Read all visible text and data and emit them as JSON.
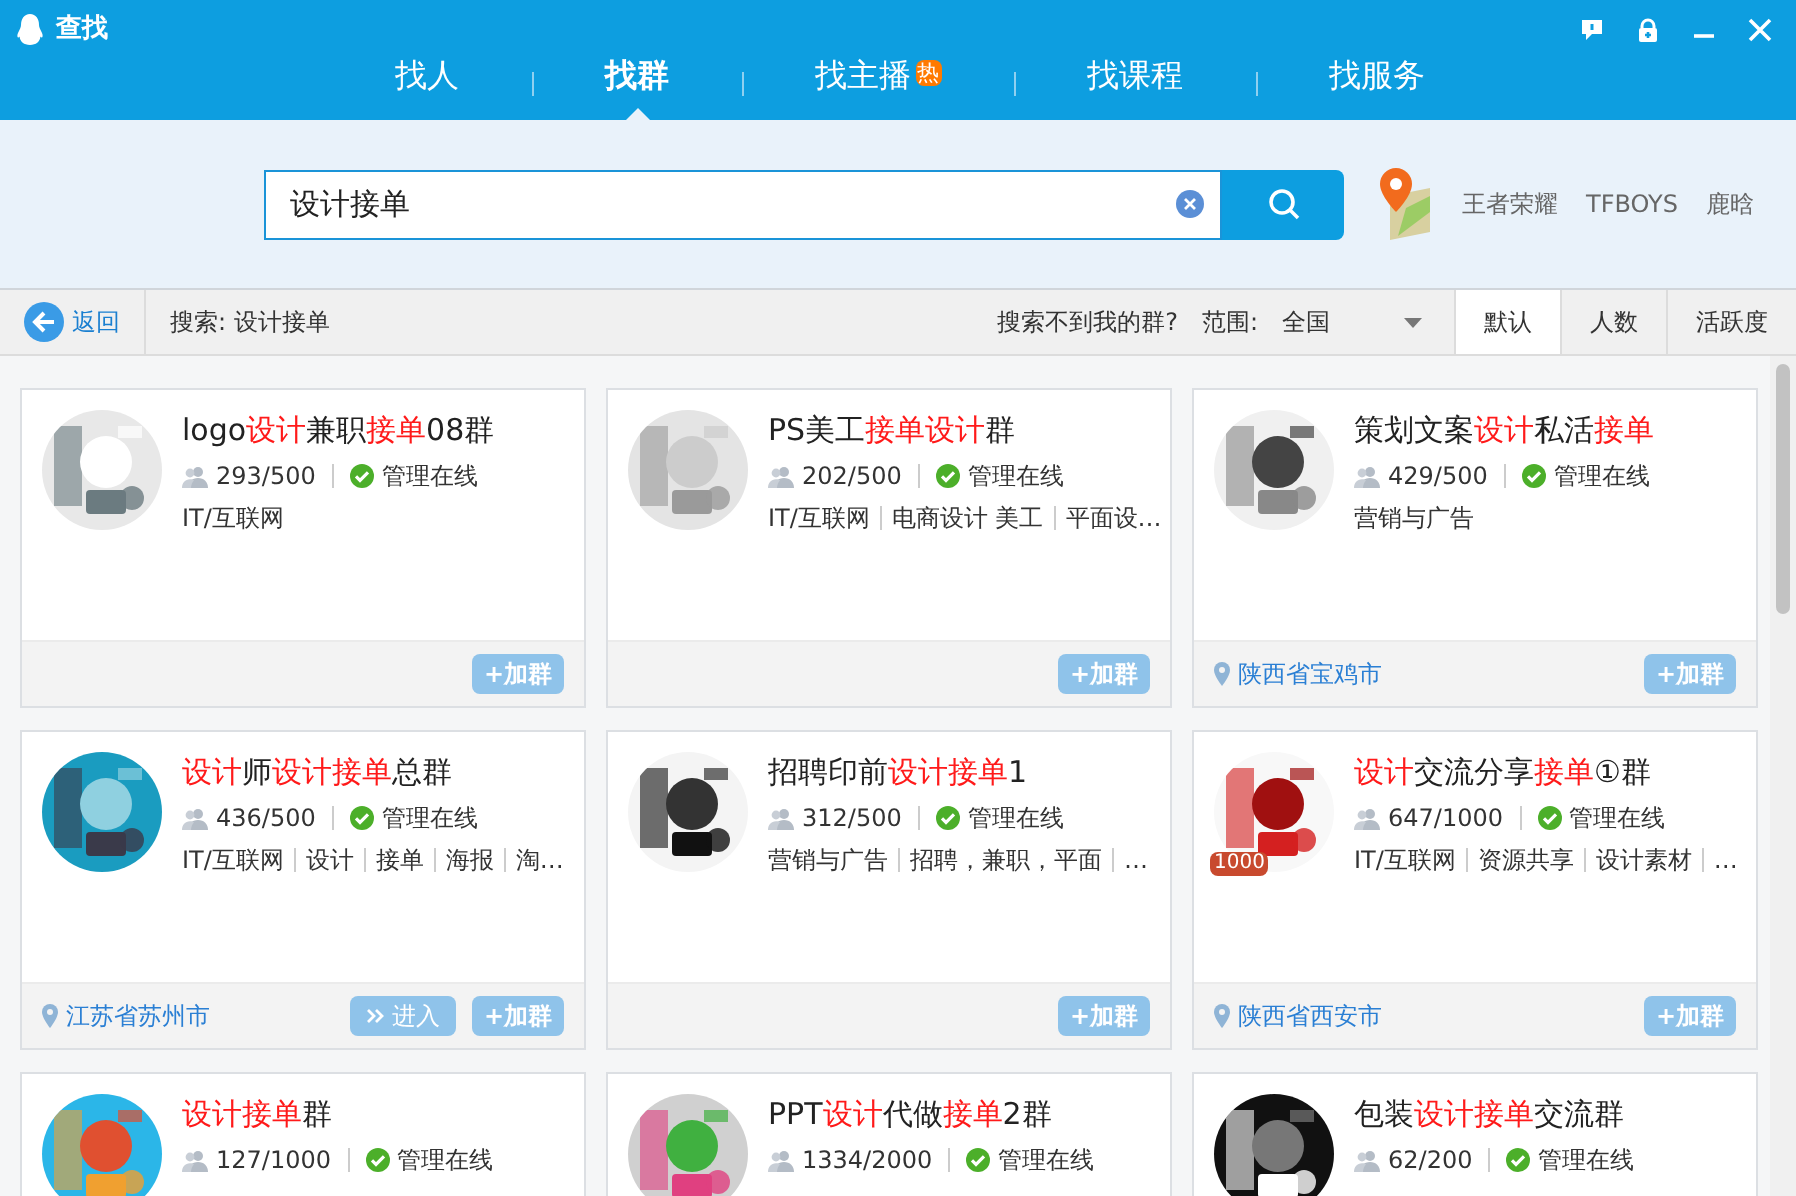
{
  "window": {
    "title": "查找"
  },
  "tabs": [
    {
      "label": "找人",
      "selected": false
    },
    {
      "label": "找群",
      "selected": true
    },
    {
      "label": "找主播",
      "selected": false,
      "badge": "热"
    },
    {
      "label": "找课程",
      "selected": false
    },
    {
      "label": "找服务",
      "selected": false
    }
  ],
  "search": {
    "value": "设计接单"
  },
  "hot_words": [
    "王者荣耀",
    "TFBOYS",
    "鹿晗"
  ],
  "toolbar": {
    "back": "返回",
    "query": "搜索: 设计接单",
    "help_link": "搜索不到我的群?",
    "scope_label": "范围:",
    "scope": "全国",
    "sort_tabs": [
      {
        "label": "默认",
        "selected": true
      },
      {
        "label": "人数",
        "selected": false
      },
      {
        "label": "活跃度",
        "selected": false
      }
    ]
  },
  "groups": [
    {
      "title": [
        {
          "text": "logo",
          "highlight": false
        },
        {
          "text": "设计",
          "highlight": true
        },
        {
          "text": "兼职",
          "highlight": false
        },
        {
          "text": "接单",
          "highlight": true
        },
        {
          "text": "08群",
          "highlight": false
        }
      ],
      "members": "293/500",
      "admin": "管理在线",
      "tags": [
        "IT/互联网"
      ],
      "join": "+加群"
    },
    {
      "title": [
        {
          "text": "PS美工",
          "highlight": false
        },
        {
          "text": "接单设计",
          "highlight": true
        },
        {
          "text": "群",
          "highlight": false
        }
      ],
      "members": "202/500",
      "admin": "管理在线",
      "tags": [
        "IT/互联网",
        "电商设计 美工",
        "平面设…"
      ],
      "join": "+加群"
    },
    {
      "title": [
        {
          "text": "策划文案",
          "highlight": false
        },
        {
          "text": "设计",
          "highlight": true
        },
        {
          "text": "私活",
          "highlight": false
        },
        {
          "text": "接单",
          "highlight": true
        }
      ],
      "members": "429/500",
      "admin": "管理在线",
      "tags": [
        "营销与广告"
      ],
      "location": "陕西省宝鸡市",
      "join": "+加群"
    },
    {
      "title": [
        {
          "text": "设计",
          "highlight": true
        },
        {
          "text": "师",
          "highlight": false
        },
        {
          "text": "设计接单",
          "highlight": true
        },
        {
          "text": "总群",
          "highlight": false
        }
      ],
      "members": "436/500",
      "admin": "管理在线",
      "tags": [
        "IT/互联网",
        "设计",
        "接单",
        "海报",
        "淘…"
      ],
      "location": "江苏省苏州市",
      "enter": "进入",
      "join": "+加群"
    },
    {
      "title": [
        {
          "text": "招聘印前",
          "highlight": false
        },
        {
          "text": "设计接单",
          "highlight": true
        },
        {
          "text": "1",
          "highlight": false
        }
      ],
      "members": "312/500",
      "admin": "管理在线",
      "tags": [
        "营销与广告",
        "招聘，兼职，平面",
        "…"
      ],
      "join": "+加群"
    },
    {
      "title": [
        {
          "text": "设计",
          "highlight": true
        },
        {
          "text": "交流分享",
          "highlight": false
        },
        {
          "text": "接单",
          "highlight": true
        },
        {
          "text": "①群",
          "highlight": false
        }
      ],
      "members": "647/1000",
      "admin": "管理在线",
      "tags": [
        "IT/互联网",
        "资源共享",
        "设计素材",
        "…"
      ],
      "badge": "1000",
      "location": "陕西省西安市",
      "join": "+加群"
    },
    {
      "title": [
        {
          "text": "设计接单",
          "highlight": true
        },
        {
          "text": "群",
          "highlight": false
        }
      ],
      "members": "127/1000",
      "admin": "管理在线"
    },
    {
      "title": [
        {
          "text": "PPT",
          "highlight": false
        },
        {
          "text": "设计",
          "highlight": true
        },
        {
          "text": "代做",
          "highlight": false
        },
        {
          "text": "接单",
          "highlight": true
        },
        {
          "text": "2群",
          "highlight": false
        }
      ],
      "members": "1334/2000",
      "admin": "管理在线"
    },
    {
      "title": [
        {
          "text": "包装",
          "highlight": false
        },
        {
          "text": "设计接单",
          "highlight": true
        },
        {
          "text": "交流群",
          "highlight": false
        }
      ],
      "members": "62/200",
      "admin": "管理在线"
    }
  ]
}
